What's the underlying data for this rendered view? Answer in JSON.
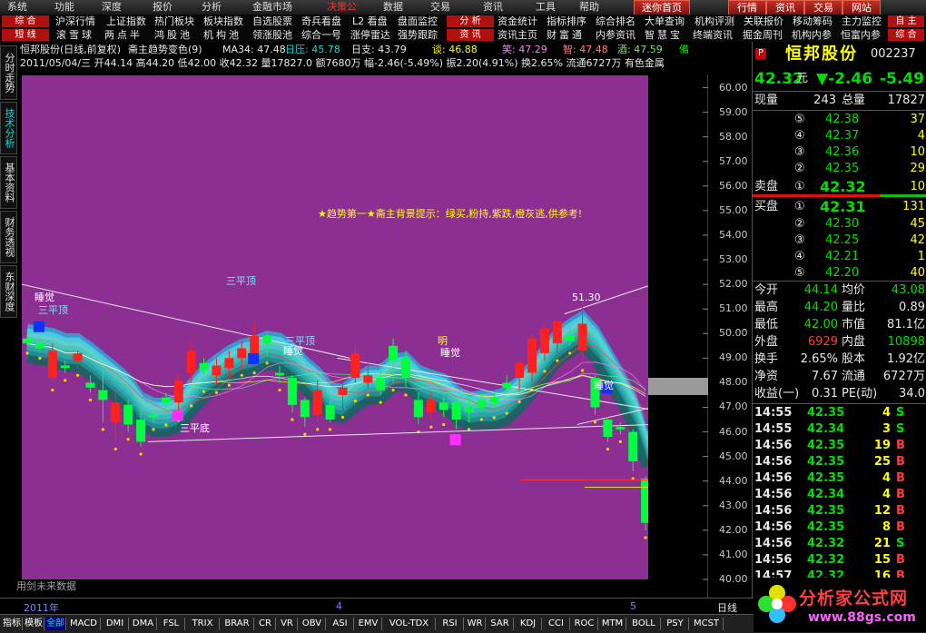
{
  "menu": [
    "系统",
    "功能",
    "深度",
    "报价",
    "分析",
    "金融市场",
    "决策公",
    "数据",
    "交易",
    "资讯",
    "工具",
    "帮助"
  ],
  "menu_right": [
    "迷你首页",
    "行情",
    "资讯",
    "交易",
    "网站"
  ],
  "quick_row1_tag": "综 合",
  "quick_row1": [
    "沪深行情",
    "上证指数",
    "热门板块",
    "板块指数",
    "自选股票",
    "奇兵看盘",
    "L2 看盘",
    "盘面监控"
  ],
  "quick_row1_tag2": "分 析",
  "quick_row1b": [
    "资金统计",
    "指标排序",
    "综合排名",
    "大单查询",
    "机构评测",
    "关联报价",
    "移动筹码",
    "主力监控"
  ],
  "quick_row1_tag3": "自 主",
  "quick_row2_tag": "短 线",
  "quick_row2": [
    "滚",
    "雪",
    "球",
    "两",
    "点",
    "半",
    "鸿",
    "股",
    "池",
    "机",
    "构",
    "池",
    "领涨股池",
    "综合一号",
    "涨停雷达",
    "强势跟踪"
  ],
  "quick_row2_tag2": "资 讯",
  "quick_row2b": [
    "资讯主页",
    "财",
    "富",
    "通",
    "内参资讯",
    "智",
    "慧",
    "宝",
    "终端资讯",
    "掘金周刊",
    "机构内参",
    "恒富内参"
  ],
  "quick_row2_tag3": "综 合",
  "vtabs": [
    "分时走势",
    "技术分析",
    "基本资料",
    "财务透视",
    "东财深度"
  ],
  "chart_header": {
    "name": "恒邦股份(日线,前复权)",
    "indicator": "斋主趋势变色(9)",
    "ma34": "MA34: 47.48",
    "rizha": "日压: 45.78",
    "rizhi": "日支: 43.79",
    "tan": "谈: 46.88",
    "xiao": "笑: 47.29",
    "zhi": "智: 47.48",
    "jiu": "酒: 47.59",
    "bei": "備"
  },
  "info_line": "2011/05/04/三 开44.14 高44.20 低42.00 收42.32 量17827.0 额7680万 幅-2.46(-5.49%) 振2.20(4.91%) 换2.65% 流通6727万 有色金属",
  "chart_text": {
    "banner": "★趋势第一★斋主背景提示：绿买,粉持,紫跌,橙灰逃,供参考!",
    "note_future": "用剑未来数据",
    "labels": [
      {
        "t": "睡觉",
        "c": "#ffffff"
      },
      {
        "t": "三平顶",
        "c": "#80e0ff"
      },
      {
        "t": "三平顶",
        "c": "#80e0ff"
      },
      {
        "t": "睡觉",
        "c": "#ffffff"
      },
      {
        "t": "三平顶",
        "c": "#80e0ff"
      },
      {
        "t": "睡觉",
        "c": "#ffffff"
      },
      {
        "t": "睡觉",
        "c": "#ffffff"
      },
      {
        "t": "三平底",
        "c": "#ffffff"
      },
      {
        "t": "51.30",
        "c": "#ffffff"
      },
      {
        "t": "42.00",
        "c": "#ffffff"
      },
      {
        "t": "明",
        "c": "#ffff00"
      }
    ]
  },
  "y_axis": [
    "60.00",
    "59.00",
    "58.00",
    "57.00",
    "56.00",
    "55.00",
    "54.00",
    "53.00",
    "52.00",
    "51.00",
    "50.00",
    "49.00",
    "48.00",
    "47.00",
    "46.00",
    "45.00",
    "44.00",
    "43.00",
    "42.00",
    "41.00",
    "40.00"
  ],
  "chart_data": {
    "type": "candlestick",
    "ylim": [
      40,
      60.5
    ],
    "note": "daily candles read from chart, approximate",
    "candles": [
      {
        "o": 49.8,
        "h": 50.0,
        "l": 49.5,
        "c": 49.6
      },
      {
        "o": 49.6,
        "h": 49.8,
        "l": 49.3,
        "c": 49.4
      },
      {
        "o": 48.2,
        "h": 49.6,
        "l": 48.0,
        "c": 49.3
      },
      {
        "o": 48.7,
        "h": 48.9,
        "l": 48.4,
        "c": 48.6
      },
      {
        "o": 48.9,
        "h": 49.3,
        "l": 48.6,
        "c": 49.2
      },
      {
        "o": 48.0,
        "h": 48.3,
        "l": 47.6,
        "c": 47.8
      },
      {
        "o": 47.7,
        "h": 48.6,
        "l": 46.4,
        "c": 47.3
      },
      {
        "o": 46.4,
        "h": 47.8,
        "l": 45.6,
        "c": 47.2
      },
      {
        "o": 47.1,
        "h": 47.3,
        "l": 46.0,
        "c": 46.3
      },
      {
        "o": 46.5,
        "h": 47.0,
        "l": 45.4,
        "c": 45.6
      },
      {
        "o": 46.7,
        "h": 46.8,
        "l": 46.4,
        "c": 46.6
      },
      {
        "o": 47.4,
        "h": 47.6,
        "l": 46.9,
        "c": 47.2
      },
      {
        "o": 47.2,
        "h": 48.3,
        "l": 46.9,
        "c": 48.1
      },
      {
        "o": 48.4,
        "h": 49.7,
        "l": 48.0,
        "c": 49.3
      },
      {
        "o": 48.8,
        "h": 49.0,
        "l": 48.3,
        "c": 48.5
      },
      {
        "o": 48.3,
        "h": 49.0,
        "l": 47.9,
        "c": 48.7
      },
      {
        "o": 48.6,
        "h": 49.3,
        "l": 48.2,
        "c": 49.0
      },
      {
        "o": 49.0,
        "h": 49.7,
        "l": 48.6,
        "c": 49.4
      },
      {
        "o": 48.9,
        "h": 50.5,
        "l": 48.7,
        "c": 49.9
      },
      {
        "o": 49.9,
        "h": 50.0,
        "l": 49.1,
        "c": 49.6
      },
      {
        "o": 48.4,
        "h": 48.7,
        "l": 48.0,
        "c": 48.3
      },
      {
        "o": 48.2,
        "h": 48.3,
        "l": 46.8,
        "c": 47.1
      },
      {
        "o": 47.3,
        "h": 47.4,
        "l": 46.2,
        "c": 46.6
      },
      {
        "o": 46.7,
        "h": 48.1,
        "l": 46.4,
        "c": 47.7
      },
      {
        "o": 47.1,
        "h": 47.3,
        "l": 46.4,
        "c": 46.5
      },
      {
        "o": 47.5,
        "h": 48.0,
        "l": 46.9,
        "c": 47.8
      },
      {
        "o": 48.2,
        "h": 49.5,
        "l": 48.0,
        "c": 49.2
      },
      {
        "o": 48.0,
        "h": 48.8,
        "l": 47.8,
        "c": 48.3
      },
      {
        "o": 48.2,
        "h": 48.8,
        "l": 47.5,
        "c": 47.7
      },
      {
        "o": 49.5,
        "h": 49.8,
        "l": 48.0,
        "c": 48.9
      },
      {
        "o": 49.0,
        "h": 49.3,
        "l": 47.8,
        "c": 48.2
      },
      {
        "o": 47.3,
        "h": 47.6,
        "l": 46.3,
        "c": 46.6
      },
      {
        "o": 46.8,
        "h": 47.6,
        "l": 46.5,
        "c": 47.3
      },
      {
        "o": 47.2,
        "h": 47.4,
        "l": 46.6,
        "c": 46.9
      },
      {
        "o": 47.2,
        "h": 47.3,
        "l": 46.1,
        "c": 46.5
      },
      {
        "o": 47.0,
        "h": 47.5,
        "l": 46.4,
        "c": 46.8
      },
      {
        "o": 47.3,
        "h": 47.5,
        "l": 46.8,
        "c": 47.0
      },
      {
        "o": 47.4,
        "h": 47.6,
        "l": 47.0,
        "c": 47.2
      },
      {
        "o": 48.0,
        "h": 48.3,
        "l": 47.6,
        "c": 47.8
      },
      {
        "o": 48.2,
        "h": 48.9,
        "l": 47.7,
        "c": 48.8
      },
      {
        "o": 48.4,
        "h": 50.0,
        "l": 48.0,
        "c": 49.8
      },
      {
        "o": 49.2,
        "h": 50.4,
        "l": 48.9,
        "c": 50.2
      },
      {
        "o": 49.6,
        "h": 50.5,
        "l": 49.2,
        "c": 50.5
      },
      {
        "o": 49.9,
        "h": 50.3,
        "l": 49.5,
        "c": 49.7
      },
      {
        "o": 49.3,
        "h": 51.3,
        "l": 48.8,
        "c": 50.4
      },
      {
        "o": 48.2,
        "h": 48.3,
        "l": 46.7,
        "c": 47.0
      },
      {
        "o": 46.5,
        "h": 46.6,
        "l": 45.6,
        "c": 45.8
      },
      {
        "o": 46.2,
        "h": 46.4,
        "l": 45.9,
        "c": 46.1
      },
      {
        "o": 46.0,
        "h": 46.1,
        "l": 44.4,
        "c": 44.8
      },
      {
        "o": 44.1,
        "h": 44.2,
        "l": 42.0,
        "c": 42.3
      }
    ]
  },
  "quote": {
    "badge": "P",
    "name": "恒邦股份",
    "code": "002237",
    "price": "42.32",
    "yuan": "元",
    "chg": "▼-2.46",
    "pct": "-5.49",
    "xianliang_label": "现量",
    "xianliang": "243",
    "zongliang_label": "总量",
    "zongliang": "17827",
    "sells": [
      {
        "n": "⑤",
        "p": "42.38",
        "v": "37"
      },
      {
        "n": "④",
        "p": "42.37",
        "v": "4"
      },
      {
        "n": "③",
        "p": "42.36",
        "v": "10"
      },
      {
        "n": "②",
        "p": "42.35",
        "v": "29"
      }
    ],
    "sell1_label": "卖盘",
    "sell1_n": "①",
    "sell1_p": "42.32",
    "sell1_v": "10",
    "buy1_label": "买盘",
    "buy1_n": "①",
    "buy1_p": "42.31",
    "buy1_v": "131",
    "buys": [
      {
        "n": "②",
        "p": "42.30",
        "v": "45"
      },
      {
        "n": "③",
        "p": "42.25",
        "v": "42"
      },
      {
        "n": "④",
        "p": "42.21",
        "v": "1"
      },
      {
        "n": "⑤",
        "p": "42.20",
        "v": "40"
      }
    ],
    "stats": [
      {
        "l1": "今开",
        "v1": "44.14",
        "c1": "g",
        "l2": "均价",
        "v2": "43.08",
        "c2": "g"
      },
      {
        "l1": "最高",
        "v1": "44.20",
        "c1": "g",
        "l2": "量比",
        "v2": "0.89",
        "c2": "w"
      },
      {
        "l1": "最低",
        "v1": "42.00",
        "c1": "g",
        "l2": "市值",
        "v2": "81.1亿",
        "c2": "w"
      },
      {
        "l1": "外盘",
        "v1": "6929",
        "c1": "r",
        "l2": "内盘",
        "v2": "10898",
        "c2": "g"
      },
      {
        "l1": "换手",
        "v1": "2.65%",
        "c1": "w",
        "l2": "股本",
        "v2": "1.92亿",
        "c2": "w"
      },
      {
        "l1": "净资",
        "v1": "7.67",
        "c1": "w",
        "l2": "流通",
        "v2": "6727万",
        "c2": "w"
      },
      {
        "l1": "收益(一)",
        "v1": "0.31",
        "c1": "w",
        "l2": "PE(动)",
        "v2": "34.0",
        "c2": "w"
      }
    ],
    "ticks": [
      {
        "t": "14:55",
        "p": "42.35",
        "v": "4",
        "s": "S"
      },
      {
        "t": "14:55",
        "p": "42.34",
        "v": "3",
        "s": "S"
      },
      {
        "t": "14:56",
        "p": "42.35",
        "v": "19",
        "s": "B"
      },
      {
        "t": "14:56",
        "p": "42.35",
        "v": "25",
        "s": "B"
      },
      {
        "t": "14:56",
        "p": "42.35",
        "v": "4",
        "s": "B"
      },
      {
        "t": "14:56",
        "p": "42.34",
        "v": "4",
        "s": "B"
      },
      {
        "t": "14:56",
        "p": "42.35",
        "v": "12",
        "s": "B"
      },
      {
        "t": "14:56",
        "p": "42.35",
        "v": "8",
        "s": "B"
      },
      {
        "t": "14:56",
        "p": "42.32",
        "v": "21",
        "s": "S"
      },
      {
        "t": "14:56",
        "p": "42.32",
        "v": "15",
        "s": "B"
      },
      {
        "t": "14:57",
        "p": "42.32",
        "v": "16",
        "s": "B"
      }
    ]
  },
  "datebar": {
    "year": "2011年",
    "m4": "4",
    "m5": "5",
    "rizhi": "日线"
  },
  "tabs": [
    "指标",
    "模板",
    "全部",
    "MACD",
    "DMI",
    "DMA",
    "FSL",
    "TRIX",
    "BRAR",
    "CR",
    "VR",
    "OBV",
    "ASI",
    "EMV",
    "VOL-TDX",
    "RSI",
    "WR",
    "SAR",
    "KDJ",
    "CCI",
    "ROC",
    "MTM",
    "BOLL",
    "PSY",
    "MCST"
  ],
  "logo": {
    "title": "分析家公式网",
    "url": "www.88gs.com"
  }
}
